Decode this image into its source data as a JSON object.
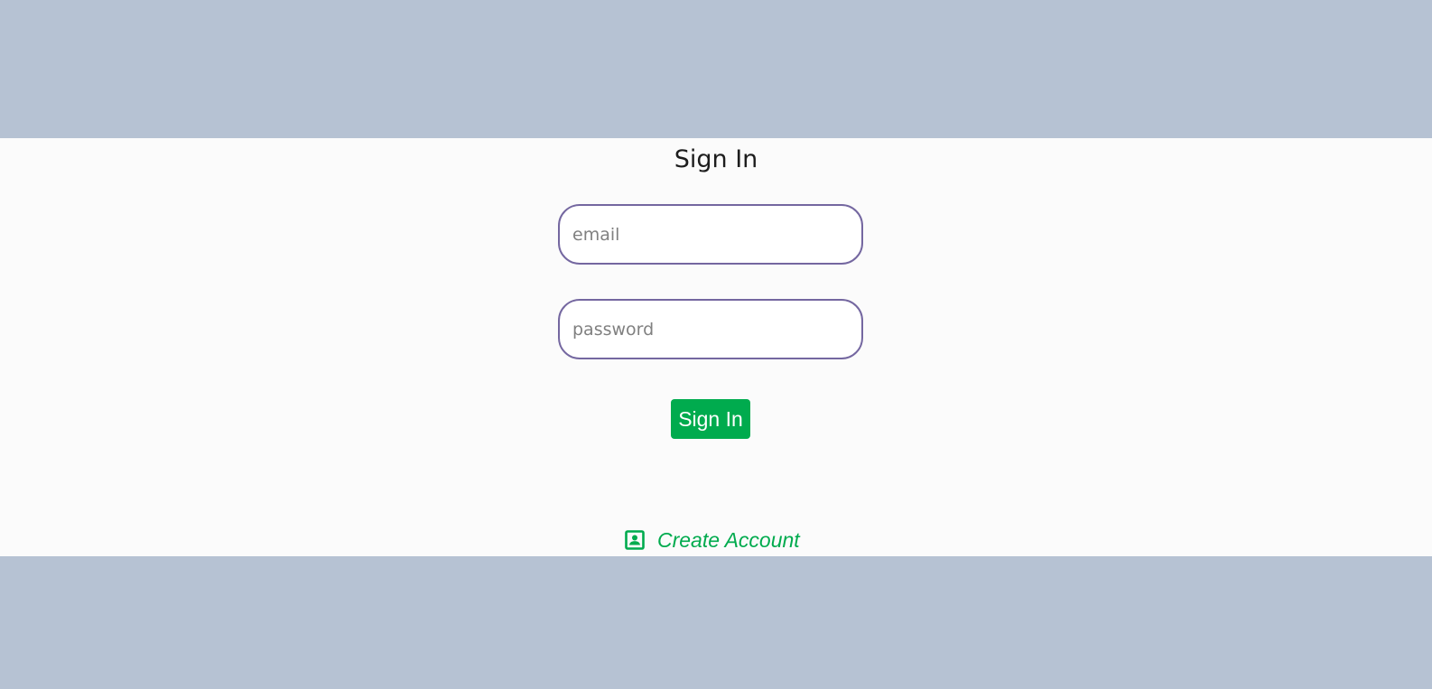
{
  "signin": {
    "title": "Sign In",
    "email_placeholder": "email",
    "email_value": "",
    "password_placeholder": "password",
    "password_value": "",
    "submit_label": "Sign In"
  },
  "create_account": {
    "label": "Create Account",
    "icon": "account-box-icon"
  },
  "colors": {
    "background_band": "#b6c2d3",
    "panel": "#fbfbfb",
    "input_border": "#7467a0",
    "accent_green": "#00ab4e"
  }
}
